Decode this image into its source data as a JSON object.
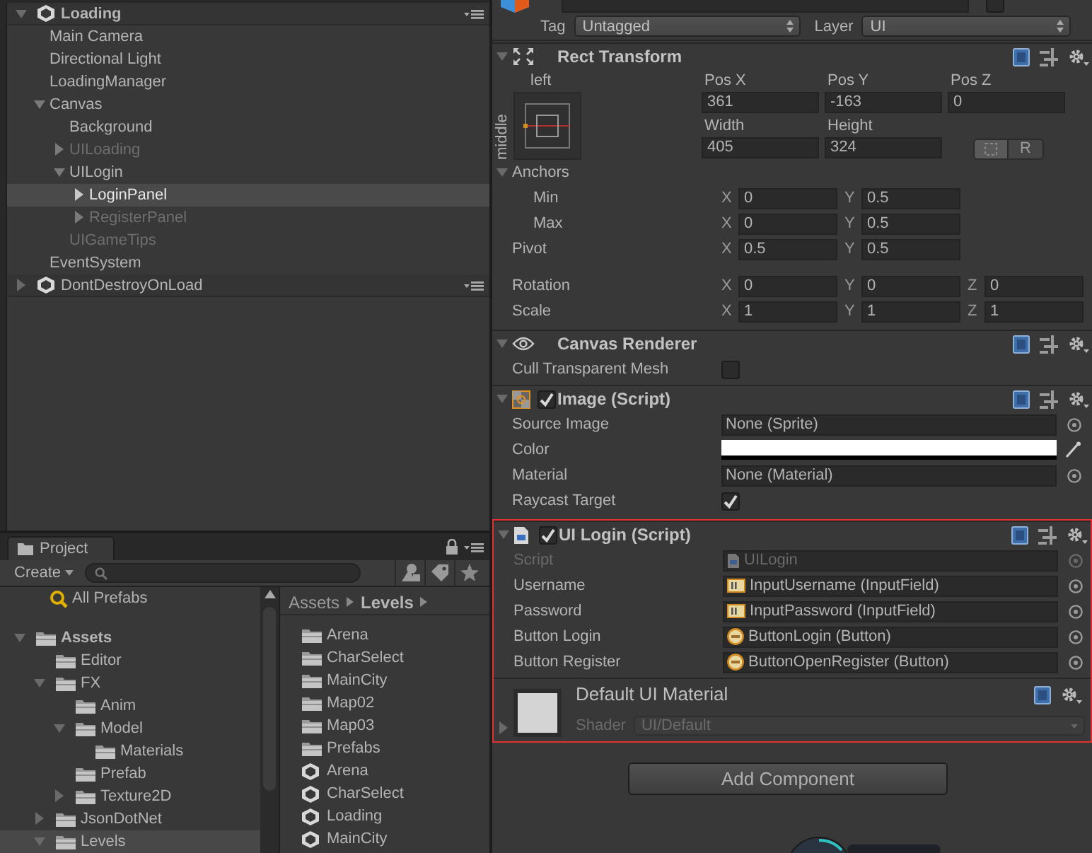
{
  "hierarchy": {
    "scenes": [
      {
        "label": "Loading",
        "active": true,
        "expanded": true,
        "children": [
          {
            "label": "Main Camera",
            "active": true,
            "selected": false
          },
          {
            "label": "Directional Light",
            "active": true,
            "selected": false
          },
          {
            "label": "LoadingManager",
            "active": true,
            "selected": false
          },
          {
            "label": "Canvas",
            "active": true,
            "selected": false,
            "expanded": true,
            "children": [
              {
                "label": "Background",
                "active": true,
                "selected": false
              },
              {
                "label": "UILoading",
                "active": false,
                "selected": false,
                "expanded": false
              },
              {
                "label": "UILogin",
                "active": true,
                "selected": false,
                "expanded": true,
                "children": [
                  {
                    "label": "LoginPanel",
                    "active": true,
                    "selected": true,
                    "expanded": false
                  },
                  {
                    "label": "RegisterPanel",
                    "active": false,
                    "selected": false,
                    "expanded": false
                  }
                ]
              },
              {
                "label": "UIGameTips",
                "active": false,
                "selected": false
              }
            ]
          },
          {
            "label": "EventSystem",
            "active": true,
            "selected": false
          }
        ]
      },
      {
        "label": "DontDestroyOnLoad",
        "active": false,
        "expanded": false
      }
    ]
  },
  "project": {
    "tab": "Project",
    "create": "Create",
    "favorites": [
      {
        "label": "All Prefabs",
        "selected": false
      }
    ],
    "tree": [
      {
        "label": "Assets",
        "selected": false,
        "expanded": true,
        "children": [
          {
            "label": "Editor",
            "selected": false
          },
          {
            "label": "FX",
            "selected": false,
            "expanded": true,
            "children": [
              {
                "label": "Anim",
                "selected": false
              },
              {
                "label": "Model",
                "selected": false,
                "expanded": true,
                "children": [
                  {
                    "label": "Materials",
                    "selected": false
                  }
                ]
              },
              {
                "label": "Prefab",
                "selected": false
              },
              {
                "label": "Texture2D",
                "selected": false,
                "expanded": false
              }
            ]
          },
          {
            "label": "JsonDotNet",
            "selected": false,
            "expanded": false
          },
          {
            "label": "Levels",
            "selected": true,
            "expanded": true
          }
        ]
      }
    ],
    "breadcrumb": [
      "Assets",
      "Levels"
    ],
    "items": [
      {
        "label": "Arena",
        "kind": "folder"
      },
      {
        "label": "CharSelect",
        "kind": "folder"
      },
      {
        "label": "MainCity",
        "kind": "folder"
      },
      {
        "label": "Map02",
        "kind": "folder"
      },
      {
        "label": "Map03",
        "kind": "folder"
      },
      {
        "label": "Prefabs",
        "kind": "folder"
      },
      {
        "label": "Arena",
        "kind": "scene"
      },
      {
        "label": "CharSelect",
        "kind": "scene"
      },
      {
        "label": "Loading",
        "kind": "scene"
      },
      {
        "label": "MainCity",
        "kind": "scene"
      }
    ]
  },
  "inspector": {
    "static": {
      "checked": false
    },
    "tag": {
      "label": "Tag",
      "value": "Untagged"
    },
    "layer": {
      "label": "Layer",
      "value": "UI"
    },
    "components": [
      {
        "kind": "rect_transform",
        "title": "Rect Transform",
        "expanded": true,
        "highlighted": false,
        "anchor_labels": {
          "horizontal": "left",
          "vertical": "middle"
        },
        "position": [
          {
            "label": "Pos X",
            "value": "361"
          },
          {
            "label": "Pos Y",
            "value": "-163"
          },
          {
            "label": "Pos Z",
            "value": "0"
          }
        ],
        "size": [
          {
            "label": "Width",
            "value": "405"
          },
          {
            "label": "Height",
            "value": "324"
          }
        ],
        "raw_button": "R",
        "anchors": {
          "label": "Anchors",
          "expanded": true,
          "rows": [
            {
              "label": "Min",
              "fields": [
                {
                  "axis": "X",
                  "value": "0"
                },
                {
                  "axis": "Y",
                  "value": "0.5"
                }
              ]
            },
            {
              "label": "Max",
              "fields": [
                {
                  "axis": "X",
                  "value": "0"
                },
                {
                  "axis": "Y",
                  "value": "0.5"
                }
              ]
            }
          ]
        },
        "pivot": {
          "label": "Pivot",
          "fields": [
            {
              "axis": "X",
              "value": "0.5"
            },
            {
              "axis": "Y",
              "value": "0.5"
            }
          ]
        },
        "rows": [
          {
            "label": "Rotation",
            "fields": [
              {
                "axis": "X",
                "value": "0"
              },
              {
                "axis": "Y",
                "value": "0"
              },
              {
                "axis": "Z",
                "value": "0"
              }
            ]
          },
          {
            "label": "Scale",
            "fields": [
              {
                "axis": "X",
                "value": "1"
              },
              {
                "axis": "Y",
                "value": "1"
              },
              {
                "axis": "Z",
                "value": "1"
              }
            ]
          }
        ]
      },
      {
        "kind": "renderer",
        "title": "Canvas Renderer",
        "expanded": true,
        "highlighted": false,
        "properties": [
          {
            "label": "Cull Transparent Mesh",
            "kind": "checkbox",
            "checked": false,
            "disabled": false
          }
        ]
      },
      {
        "kind": "image",
        "title": "Image (Script)",
        "expanded": true,
        "enabled": true,
        "highlighted": false,
        "properties": [
          {
            "label": "Source Image",
            "kind": "object",
            "value": "None (Sprite)",
            "disabled": false
          },
          {
            "label": "Color",
            "kind": "color",
            "color": "#ffffff",
            "disabled": false
          },
          {
            "label": "Material",
            "kind": "object",
            "value": "None (Material)",
            "disabled": false
          },
          {
            "label": "Raycast Target",
            "kind": "checkbox",
            "checked": true,
            "disabled": false
          }
        ]
      },
      {
        "kind": "script",
        "title": "UI Login (Script)",
        "expanded": true,
        "enabled": true,
        "highlighted": true,
        "properties": [
          {
            "label": "Script",
            "kind": "script_ref",
            "value": "UILogin",
            "disabled": true
          },
          {
            "label": "Username",
            "kind": "input_ref",
            "value": "InputUsername (InputField)",
            "disabled": false
          },
          {
            "label": "Password",
            "kind": "input_ref",
            "value": "InputPassword (InputField)",
            "disabled": false
          },
          {
            "label": "Button Login",
            "kind": "button_ref",
            "value": "ButtonLogin (Button)",
            "disabled": false
          },
          {
            "label": "Button Register",
            "kind": "button_ref",
            "value": "ButtonOpenRegister (Button)",
            "disabled": false
          }
        ]
      },
      {
        "kind": "material",
        "title": "Default UI Material",
        "expanded": false,
        "highlighted": true,
        "shader_label": "Shader",
        "shader": "UI/Default"
      }
    ],
    "add_component": "Add Component"
  }
}
